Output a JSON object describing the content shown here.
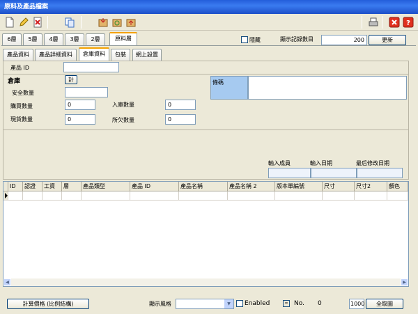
{
  "window": {
    "title": "原料及產品檔案"
  },
  "level_tabs": [
    "6層",
    "5層",
    "4層",
    "3層",
    "2層",
    "原料層"
  ],
  "header": {
    "hidden_label": "隱藏",
    "display_count_label": "顯示記錄數目",
    "display_count_value": "200",
    "update_button": "更新"
  },
  "sub_tabs": [
    "產品資料",
    "產品詳細資料",
    "倉庫資料",
    "包裝",
    "網上設置"
  ],
  "form": {
    "product_id_label": "產品 ID",
    "product_id_value": "",
    "warehouse_label": "倉庫",
    "calc_button": "計",
    "safety_qty_label": "安全數量",
    "safety_qty_value": "",
    "purchase_qty_label": "購買數量",
    "purchase_qty_value": "0",
    "stock_in_qty_label": "入庫數量",
    "stock_in_qty_value": "0",
    "current_qty_label": "現貨數量",
    "current_qty_value": "0",
    "owed_qty_label": "所欠數量",
    "owed_qty_value": "0",
    "barcode_label": "條碼",
    "barcode_value": "",
    "input_staff_label": "輸入成員",
    "input_date_label": "輸入日期",
    "last_modified_label": "最后修改日期"
  },
  "table": {
    "columns": [
      "ID",
      "認證",
      "工資",
      "層",
      "產品類型",
      "產品 ID",
      "產品名稱",
      "產品名稱 2",
      "版本單編號",
      "尺寸",
      "尺寸2",
      "顏色"
    ]
  },
  "footer": {
    "calc_price_button": "計算價格 (比例結構)",
    "display_style_label": "顯示風格",
    "display_style_value": "",
    "enabled_label": "Enabled",
    "no_label": "No.",
    "no_value": "0",
    "page_size_value": "1000",
    "show_all_button": "全取圖"
  },
  "colors": {
    "titlebar": "#245edb",
    "barcode_label_bg": "#a6caf0",
    "active_tab_accent": "#f4a100"
  }
}
